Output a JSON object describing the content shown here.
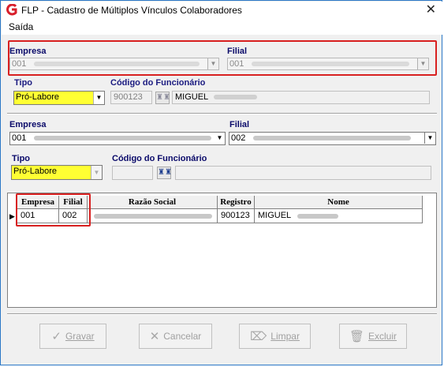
{
  "window": {
    "title": "FLP - Cadastro de Múltiplos Vínculos Colaboradores",
    "close_glyph": "✕"
  },
  "menu": {
    "items": [
      "Saída"
    ]
  },
  "top": {
    "empresa_label": "Empresa",
    "empresa_value": "001",
    "filial_label": "Filial",
    "filial_value": "001",
    "tipo_label": "Tipo",
    "tipo_value": "Pró-Labore",
    "codigo_label": "Código do Funcionário",
    "codigo_value": "900123",
    "nome_value": "MIGUEL"
  },
  "bottom": {
    "empresa_label": "Empresa",
    "empresa_value": "001",
    "filial_label": "Filial",
    "filial_value": "002",
    "tipo_label": "Tipo",
    "tipo_value": "Pró-Labore",
    "codigo_label": "Código do Funcionário",
    "codigo_value": "",
    "nome_value": ""
  },
  "grid": {
    "columns": [
      "Empresa",
      "Filial",
      "Razão Social",
      "Registro",
      "Nome"
    ],
    "rows": [
      {
        "empresa": "001",
        "filial": "002",
        "razao": "",
        "registro": "900123",
        "nome": "MIGUEL"
      }
    ]
  },
  "buttons": {
    "gravar_label": "Gravar",
    "cancelar_label": "Cancelar",
    "limpar_label": "Limpar",
    "excluir_label": "Excluir"
  },
  "colors": {
    "highlight": "#d82020",
    "tipo_bg": "#ffff33",
    "label": "#0a0a6a"
  }
}
